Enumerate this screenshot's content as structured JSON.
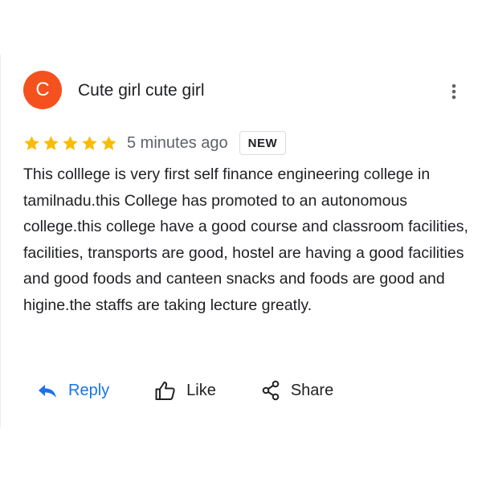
{
  "review": {
    "avatar_letter": "C",
    "avatar_color": "#f4511e",
    "author": "Cute girl cute girl",
    "rating": 5,
    "rating_max": 5,
    "star_color": "#fbbc04",
    "time": "5 minutes ago",
    "badge": "NEW",
    "text": "This colllege is very first self finance engineering college in tamilnadu.this College has promoted to an autonomous college.this college have a good course and classroom facilities, facilities, transports are good, hostel are having a good facilities and good foods and canteen snacks and foods are good and higine.the staffs are taking lecture greatly.",
    "more_icon": "more-vert-icon"
  },
  "actions": {
    "reply_label": "Reply",
    "like_label": "Like",
    "share_label": "Share",
    "reply_icon": "reply-icon",
    "like_icon": "thumb-up-icon",
    "share_icon": "share-icon",
    "accent_color": "#1a73e8"
  }
}
